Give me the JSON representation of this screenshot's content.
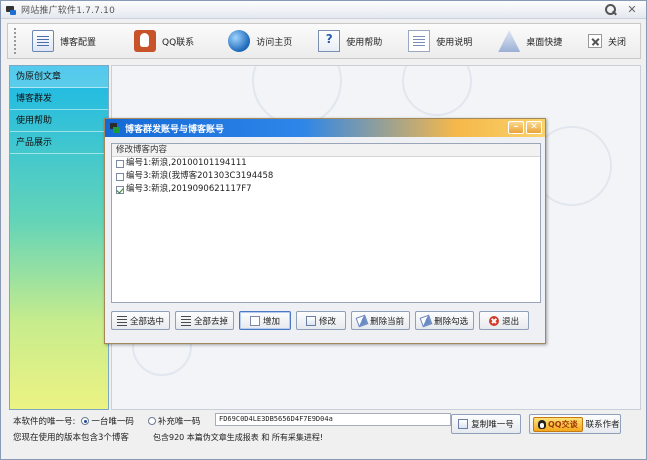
{
  "window": {
    "title": "网站推广软件1.7.7.10"
  },
  "toolbar": {
    "items": [
      {
        "label": "博客配置",
        "icon": "blog-icon"
      },
      {
        "label": "QQ联系",
        "icon": "qq-icon"
      },
      {
        "label": "访问主页",
        "icon": "globe-icon"
      },
      {
        "label": "使用帮助",
        "icon": "help-icon"
      },
      {
        "label": "使用说明",
        "icon": "doc-icon"
      },
      {
        "label": "桌面快捷",
        "icon": "desktop-icon"
      }
    ],
    "close_label": "关闭"
  },
  "sidebar": {
    "items": [
      {
        "label": "伪原创文章"
      },
      {
        "label": "博客群发"
      },
      {
        "label": "使用帮助"
      },
      {
        "label": "产品展示"
      }
    ]
  },
  "dialog": {
    "title": "博客群发账号与博客账号",
    "group_label": "修改博客内容",
    "rows": [
      {
        "text": "编号1:新浪,20100101194111",
        "checked": false
      },
      {
        "text": "编号3:新浪(我博客201303C3194458",
        "checked": false
      },
      {
        "text": "编号3:新浪,2019090621117F7",
        "checked": true
      }
    ],
    "buttons": {
      "select_all": "全部选中",
      "deselect_all": "全部去掉",
      "add": "增加",
      "edit": "修改",
      "delete_current": "删除当前",
      "delete_checked": "删除勾选",
      "exit": "退出"
    }
  },
  "bottom": {
    "unique_label": "本软件的唯一号:",
    "radio1": "一台唯一码",
    "radio2": "补充唯一码",
    "code": "FD69C0D4LE3DB5656D4F7E9D04a",
    "note1": "您现在使用的版本包含3个博客",
    "note2": "包含920 本篇伪文章生成报表 和 所有采集进程!",
    "copy_button": "复制唯一号",
    "qq_badge": "QQ交谈",
    "contact_label": "联系作者"
  }
}
